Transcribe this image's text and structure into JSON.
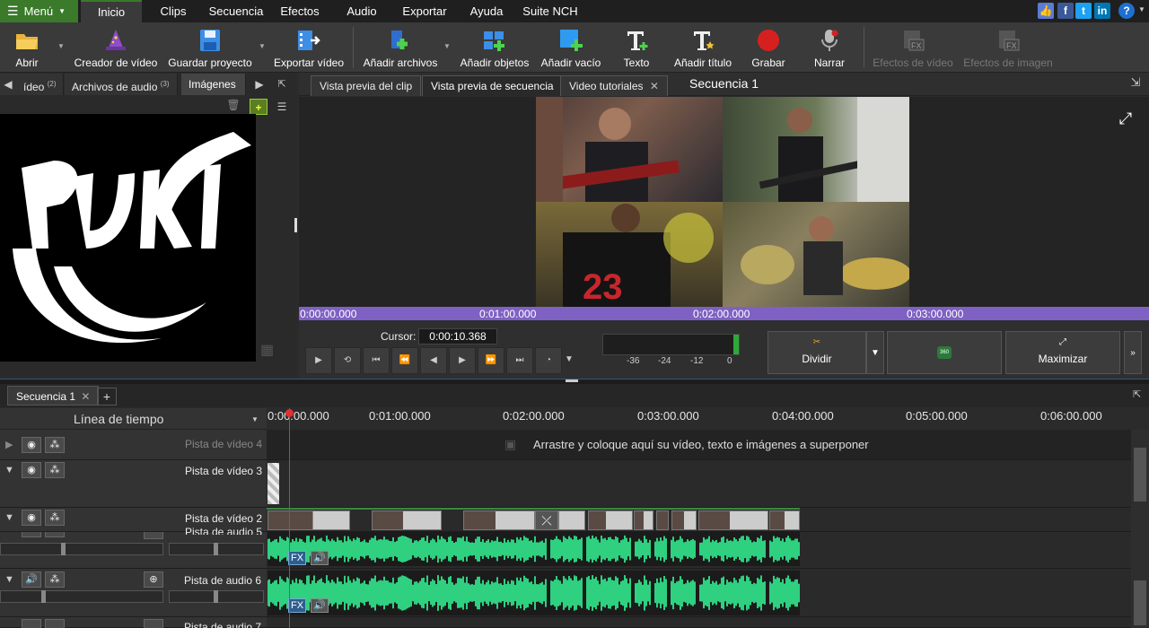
{
  "menubar": {
    "menu_label": "Menú",
    "tabs": [
      "Inicio",
      "Clips",
      "Secuencia",
      "Efectos",
      "Audio",
      "Exportar",
      "Ayuda",
      "Suite NCH"
    ],
    "social_icons": [
      "like-icon",
      "facebook-icon",
      "twitter-icon",
      "linkedin-icon",
      "help-icon"
    ]
  },
  "toolbar": {
    "abrir": "Abrir",
    "creador": "Creador de vídeo",
    "guardar": "Guardar proyecto",
    "exportar": "Exportar vídeo",
    "anadir_archivos": "Añadir archivos",
    "anadir_objetos": "Añadir objetos",
    "anadir_vacio": "Añadir vacío",
    "texto": "Texto",
    "anadir_titulo": "Añadir título",
    "grabar": "Grabar",
    "narrar": "Narrar",
    "efectos_video": "Efectos de vídeo",
    "efectos_imagen": "Efectos de imagen"
  },
  "left_panel": {
    "tabs": [
      {
        "label": "ídeo",
        "count": "(2)"
      },
      {
        "label": "Archivos de audio",
        "count": "(3)"
      },
      {
        "label": "Imágenes",
        "count": ""
      }
    ]
  },
  "preview": {
    "tabs": [
      "Vista previa del clip",
      "Vista previa de secuencia",
      "Video tutoriales"
    ],
    "sequence_title": "Secuencia 1",
    "ruler": [
      "0:00:00.000",
      "0:01:00.000",
      "0:02:00.000",
      "0:03:00.000"
    ]
  },
  "controls": {
    "cursor_label": "Cursor:",
    "cursor_value": "0:00:10.368",
    "meter_labels": [
      "-36",
      "-24",
      "-12",
      "0"
    ],
    "dividir": "Dividir",
    "maximizar": "Maximizar",
    "badge_360": "360"
  },
  "timeline": {
    "sequence_tab": "Secuencia 1",
    "header_label": "Línea de tiempo",
    "ticks": [
      "0:00:00.000",
      "0:01:00.000",
      "0:02:00.000",
      "0:03:00.000",
      "0:04:00.000",
      "0:05:00.000",
      "0:06:00.000"
    ],
    "tracks": {
      "v4": "Pista de vídeo 4",
      "v3": "Pista de vídeo 3",
      "v2": "Pista de vídeo 2",
      "a5": "Pista de audio 5",
      "a6": "Pista de audio 6",
      "a7": "Pista de audio 7"
    },
    "drop_hint": "Arrastre y coloque aquí su vídeo, texto e imágenes a superponer",
    "fx_label": "FX"
  },
  "colors": {
    "accent_green": "#3a7a2a",
    "ruler_purple": "#7e61c3",
    "waveform": "#2fd07f",
    "playhead": "#e03030"
  }
}
